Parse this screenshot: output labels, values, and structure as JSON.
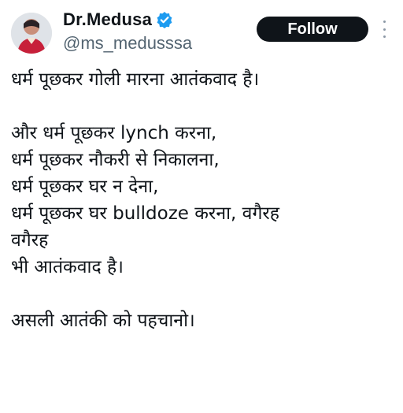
{
  "author": {
    "display_name": "Dr.Medusa",
    "handle": "@ms_medusssa",
    "verified": true,
    "avatar_icon": "profile-photo"
  },
  "actions": {
    "follow_label": "Follow",
    "more_icon": "more-vertical-icon"
  },
  "colors": {
    "text": "#0f1419",
    "secondary_text": "#536471",
    "verified_badge": "#1d9bf0",
    "follow_button_bg": "#0f1419",
    "follow_button_text": "#ffffff"
  },
  "tweet": {
    "lines": [
      "धर्म पूछकर गोली मारना आतंकवाद है।",
      "",
      "और धर्म पूछकर lynch करना,",
      "धर्म पूछकर नौकरी से निकालना,",
      "धर्म पूछकर घर न देना,",
      "धर्म पूछकर घर bulldoze करना, वगैरह",
      "वगैरह",
      "भी आतंकवाद है।",
      "",
      "असली आतंकी को पहचानो।"
    ]
  }
}
